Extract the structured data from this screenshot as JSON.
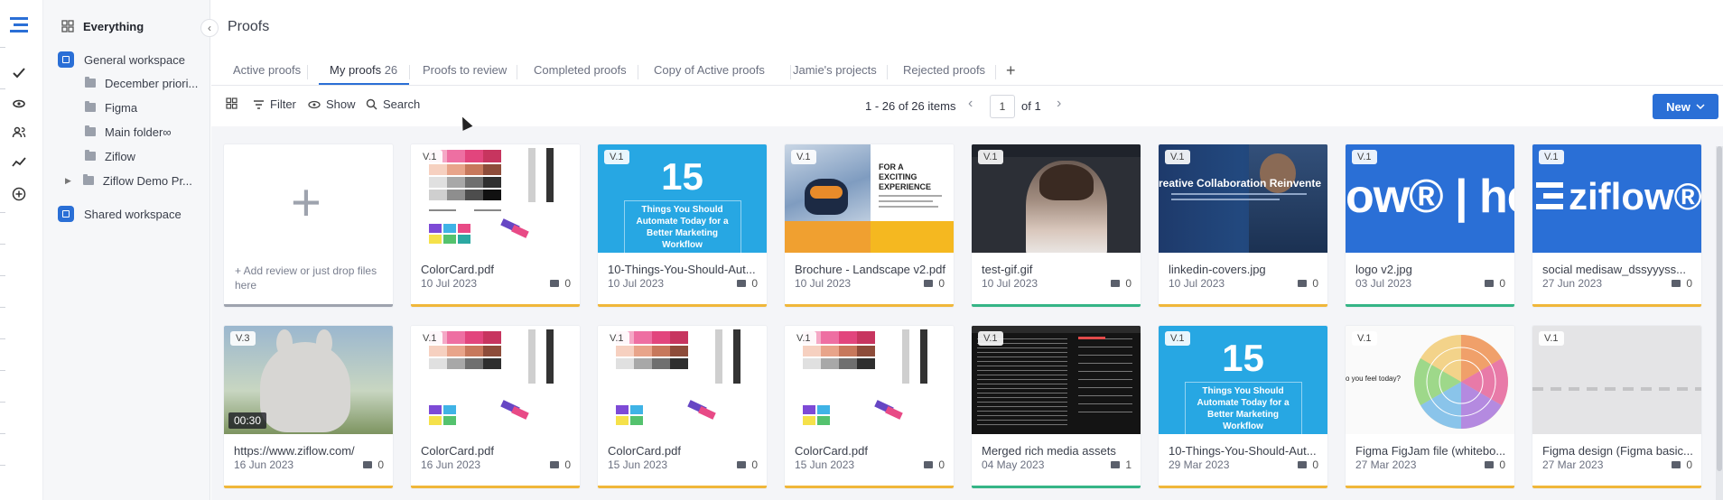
{
  "sidebar": {
    "everything": "Everything",
    "general_workspace": "General workspace",
    "folders": [
      "December priori...",
      "Figma",
      "Main folder∞",
      "Ziflow",
      "Ziflow Demo Pr..."
    ],
    "shared_workspace": "Shared workspace"
  },
  "header": {
    "title": "Proofs"
  },
  "tabs": [
    {
      "label": "Active proofs"
    },
    {
      "label": "My proofs",
      "count": "26"
    },
    {
      "label": "Proofs to review"
    },
    {
      "label": "Completed proofs"
    },
    {
      "label": "Copy of Active proofs"
    },
    {
      "label": "Jamie's projects"
    },
    {
      "label": "Rejected proofs"
    }
  ],
  "toolbar": {
    "filter": "Filter",
    "show": "Show",
    "search": "Search",
    "range": "1 - 26 of 26 items",
    "page": "1",
    "of": "of 1",
    "new": "New"
  },
  "add_card": {
    "text": "+ Add review or just drop files here"
  },
  "cards": [
    {
      "name": "ColorCard.pdf",
      "date": "10 Jul 2023",
      "comments": "0",
      "version": "V.1",
      "status_color": "#f0b73a"
    },
    {
      "name": "10-Things-You-Should-Aut...",
      "date": "10 Jul 2023",
      "comments": "0",
      "version": "V.1",
      "status_color": "#f0b73a"
    },
    {
      "name": "Brochure - Landscape v2.pdf",
      "date": "10 Jul 2023",
      "comments": "0",
      "version": "V.1",
      "status_color": "#f0b73a"
    },
    {
      "name": "test-gif.gif",
      "date": "10 Jul 2023",
      "comments": "0",
      "version": "V.1",
      "status_color": "#35b586"
    },
    {
      "name": "linkedin-covers.jpg",
      "date": "10 Jul 2023",
      "comments": "0",
      "version": "V.1",
      "status_color": "#f0b73a"
    },
    {
      "name": "logo v2.jpg",
      "date": "03 Jul 2023",
      "comments": "0",
      "version": "V.1",
      "status_color": "#35b586"
    },
    {
      "name": "social medisaw_dssyyyss...",
      "date": "27 Jun 2023",
      "comments": "0",
      "version": "V.1",
      "status_color": "#f0b73a"
    },
    {
      "name": "https://www.ziflow.com/",
      "date": "16 Jun 2023",
      "comments": "0",
      "version": "V.3",
      "duration": "00:30",
      "status_color": "#f0b73a"
    },
    {
      "name": "ColorCard.pdf",
      "date": "16 Jun 2023",
      "comments": "0",
      "version": "V.1",
      "status_color": "#f0b73a"
    },
    {
      "name": "ColorCard.pdf",
      "date": "15 Jun 2023",
      "comments": "0",
      "version": "V.1",
      "status_color": "#f0b73a"
    },
    {
      "name": "ColorCard.pdf",
      "date": "15 Jun 2023",
      "comments": "0",
      "version": "V.1",
      "status_color": "#f0b73a"
    },
    {
      "name": "Merged rich media assets",
      "date": "04 May 2023",
      "comments": "1",
      "version": "V.1",
      "status_color": "#35b586"
    },
    {
      "name": "10-Things-You-Should-Aut...",
      "date": "29 Mar 2023",
      "comments": "0",
      "version": "V.1",
      "status_color": "#f0b73a"
    },
    {
      "name": "Figma FigJam file (whitebo...",
      "date": "27 Mar 2023",
      "comments": "0",
      "version": "V.1",
      "status_color": "#f0b73a"
    },
    {
      "name": "Figma design (Figma basic...",
      "date": "27 Mar 2023",
      "comments": "0",
      "version": "V.1",
      "status_color": "#f0b73a"
    }
  ],
  "thumb_text": {
    "fifteen": "15",
    "things": "Things You Should Automate Today for a Better Marketing Workflow",
    "brochure_h": "FOR A EXCITING EXPERIENCE",
    "linkedin": "reative Collaboration Reinvente",
    "logo": "ow® | he",
    "ziflow": "ziflow®",
    "figjam_q": "o you feel today?"
  },
  "colors": {
    "accent": "#2a6fd6",
    "yellow": "#f0b73a",
    "green": "#35b586"
  }
}
